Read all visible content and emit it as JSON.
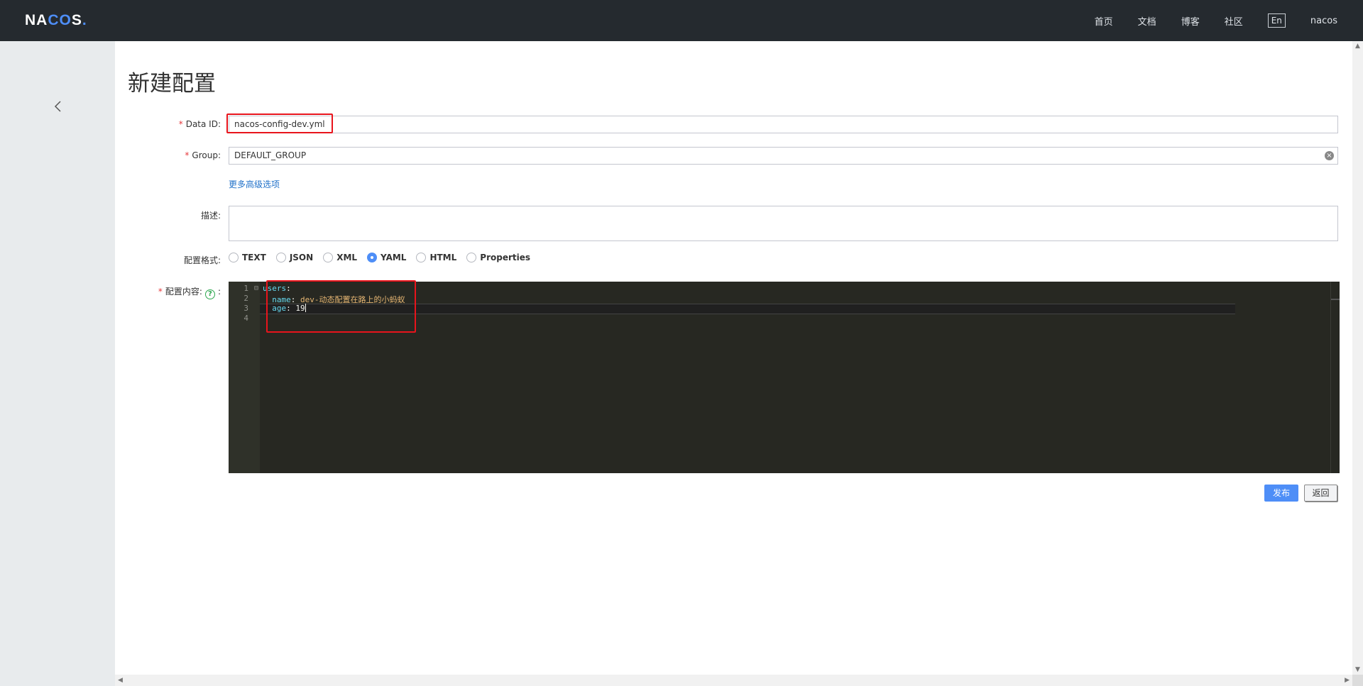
{
  "app": {
    "logo_text": "NACOS",
    "nav": [
      "首页",
      "文档",
      "博客",
      "社区"
    ],
    "lang_toggle": "En",
    "user": "nacos"
  },
  "page": {
    "title": "新建配置"
  },
  "form": {
    "data_id": {
      "label": "Data ID:",
      "required_mark": "*",
      "value": "nacos-config-dev.yml"
    },
    "group": {
      "label": "Group:",
      "required_mark": "*",
      "value": "DEFAULT_GROUP"
    },
    "advanced_link": "更多高级选项",
    "description": {
      "label": "描述:",
      "value": ""
    },
    "format": {
      "label": "配置格式:",
      "options": [
        "TEXT",
        "JSON",
        "XML",
        "YAML",
        "HTML",
        "Properties"
      ],
      "selected": "YAML"
    },
    "content": {
      "label": "配置内容:",
      "required_mark": "*",
      "help_icon": "question-circle-icon",
      "colon": ":",
      "line_numbers": [
        "1",
        "2",
        "3",
        "4"
      ],
      "lines": [
        {
          "key": "users",
          "sep": ":",
          "value": ""
        },
        {
          "indent": "  ",
          "key": "name",
          "sep": ": ",
          "value": "dev-动态配置在路上的小蚂蚁"
        },
        {
          "indent": "  ",
          "key": "age",
          "sep": ": ",
          "value": "19"
        },
        {
          "key": "",
          "sep": "",
          "value": ""
        }
      ]
    }
  },
  "actions": {
    "publish": "发布",
    "back": "返回"
  },
  "colors": {
    "topbar": "#252a2f",
    "sidebar": "#e8ebed",
    "primary": "#4e8ef7",
    "highlight": "#e8141c",
    "editor_bg": "#272822"
  }
}
